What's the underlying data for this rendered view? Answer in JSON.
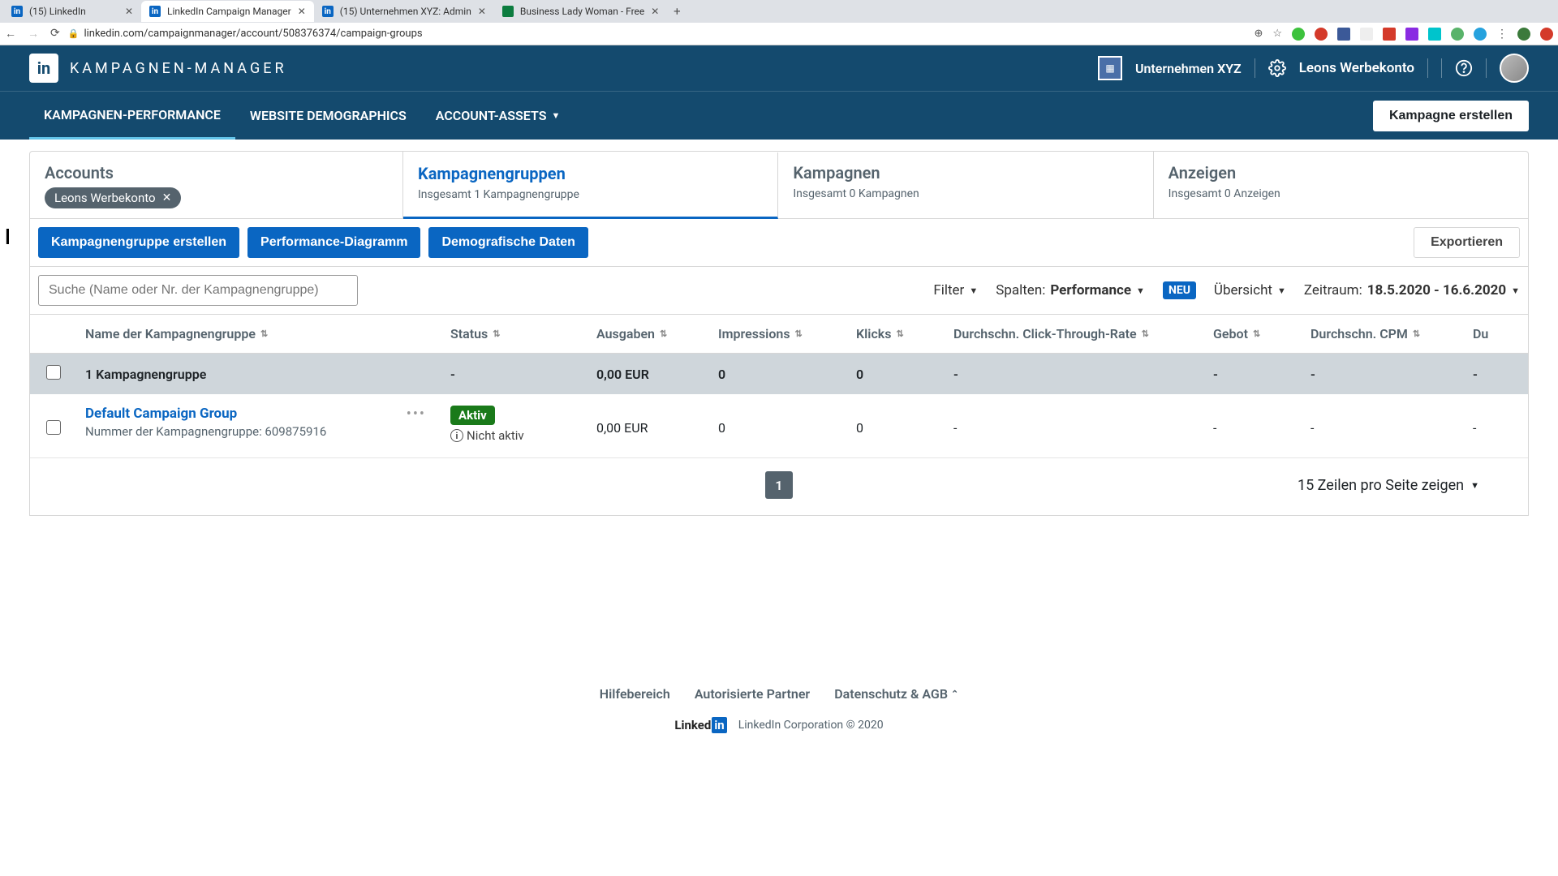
{
  "browser": {
    "tabs": [
      {
        "title": "(15) LinkedIn",
        "fav_bg": "#0a66c2",
        "fav_text": "in"
      },
      {
        "title": "LinkedIn Campaign Manager",
        "fav_bg": "#0a66c2",
        "fav_text": "in"
      },
      {
        "title": "(15) Unternehmen XYZ: Admin",
        "fav_bg": "#0a66c2",
        "fav_text": "in"
      },
      {
        "title": "Business Lady Woman - Free",
        "fav_bg": "#0c7c3f",
        "fav_text": ""
      }
    ],
    "url": "linkedin.com/campaignmanager/account/508376374/campaign-groups"
  },
  "header": {
    "app_title": "KAMPAGNEN-MANAGER",
    "company": "Unternehmen XYZ",
    "account_name": "Leons Werbekonto"
  },
  "nav": {
    "items": [
      "KAMPAGNEN-PERFORMANCE",
      "WEBSITE DEMOGRAPHICS",
      "ACCOUNT-ASSETS"
    ],
    "create_label": "Kampagne erstellen"
  },
  "level_tabs": {
    "accounts": {
      "title": "Accounts",
      "chip": "Leons Werbekonto"
    },
    "groups": {
      "title": "Kampagnengruppen",
      "sub": "Insgesamt 1 Kampagnengruppe"
    },
    "campaigns": {
      "title": "Kampagnen",
      "sub": "Insgesamt 0 Kampagnen"
    },
    "ads": {
      "title": "Anzeigen",
      "sub": "Insgesamt 0 Anzeigen"
    }
  },
  "actions": {
    "create_group": "Kampagnengruppe erstellen",
    "perf_chart": "Performance-Diagramm",
    "demo_data": "Demografische Daten",
    "export": "Exportieren"
  },
  "filters": {
    "search_placeholder": "Suche (Name oder Nr. der Kampagnengruppe)",
    "filter_label": "Filter",
    "columns_label": "Spalten:",
    "columns_value": "Performance",
    "neu": "NEU",
    "overview": "Übersicht",
    "date_label": "Zeitraum:",
    "date_value": "18.5.2020 - 16.6.2020"
  },
  "columns": {
    "name": "Name der Kampagnengruppe",
    "status": "Status",
    "spend": "Ausgaben",
    "impressions": "Impressions",
    "clicks": "Klicks",
    "ctr": "Durchschn. Click-Through-Rate",
    "bid": "Gebot",
    "cpm": "Durchschn. CPM",
    "du": "Du"
  },
  "summary": {
    "name": "1 Kampagnengruppe",
    "status": "-",
    "spend": "0,00 EUR",
    "impressions": "0",
    "clicks": "0",
    "ctr": "-",
    "bid": "-",
    "cpm": "-",
    "du": "-"
  },
  "row": {
    "name": "Default Campaign Group",
    "number": "Nummer der Kampagnengruppe: 609875916",
    "status_pill": "Aktiv",
    "status_sub": "Nicht aktiv",
    "spend": "0,00 EUR",
    "impressions": "0",
    "clicks": "0",
    "ctr": "-",
    "bid": "-",
    "cpm": "-",
    "du": "-"
  },
  "pager": {
    "page": "1",
    "rows_per": "15 Zeilen pro Seite zeigen"
  },
  "footer": {
    "help": "Hilfebereich",
    "partners": "Autorisierte Partner",
    "privacy": "Datenschutz & AGB",
    "brand_a": "Linked",
    "brand_b": "in",
    "corp": "LinkedIn Corporation © 2020"
  }
}
